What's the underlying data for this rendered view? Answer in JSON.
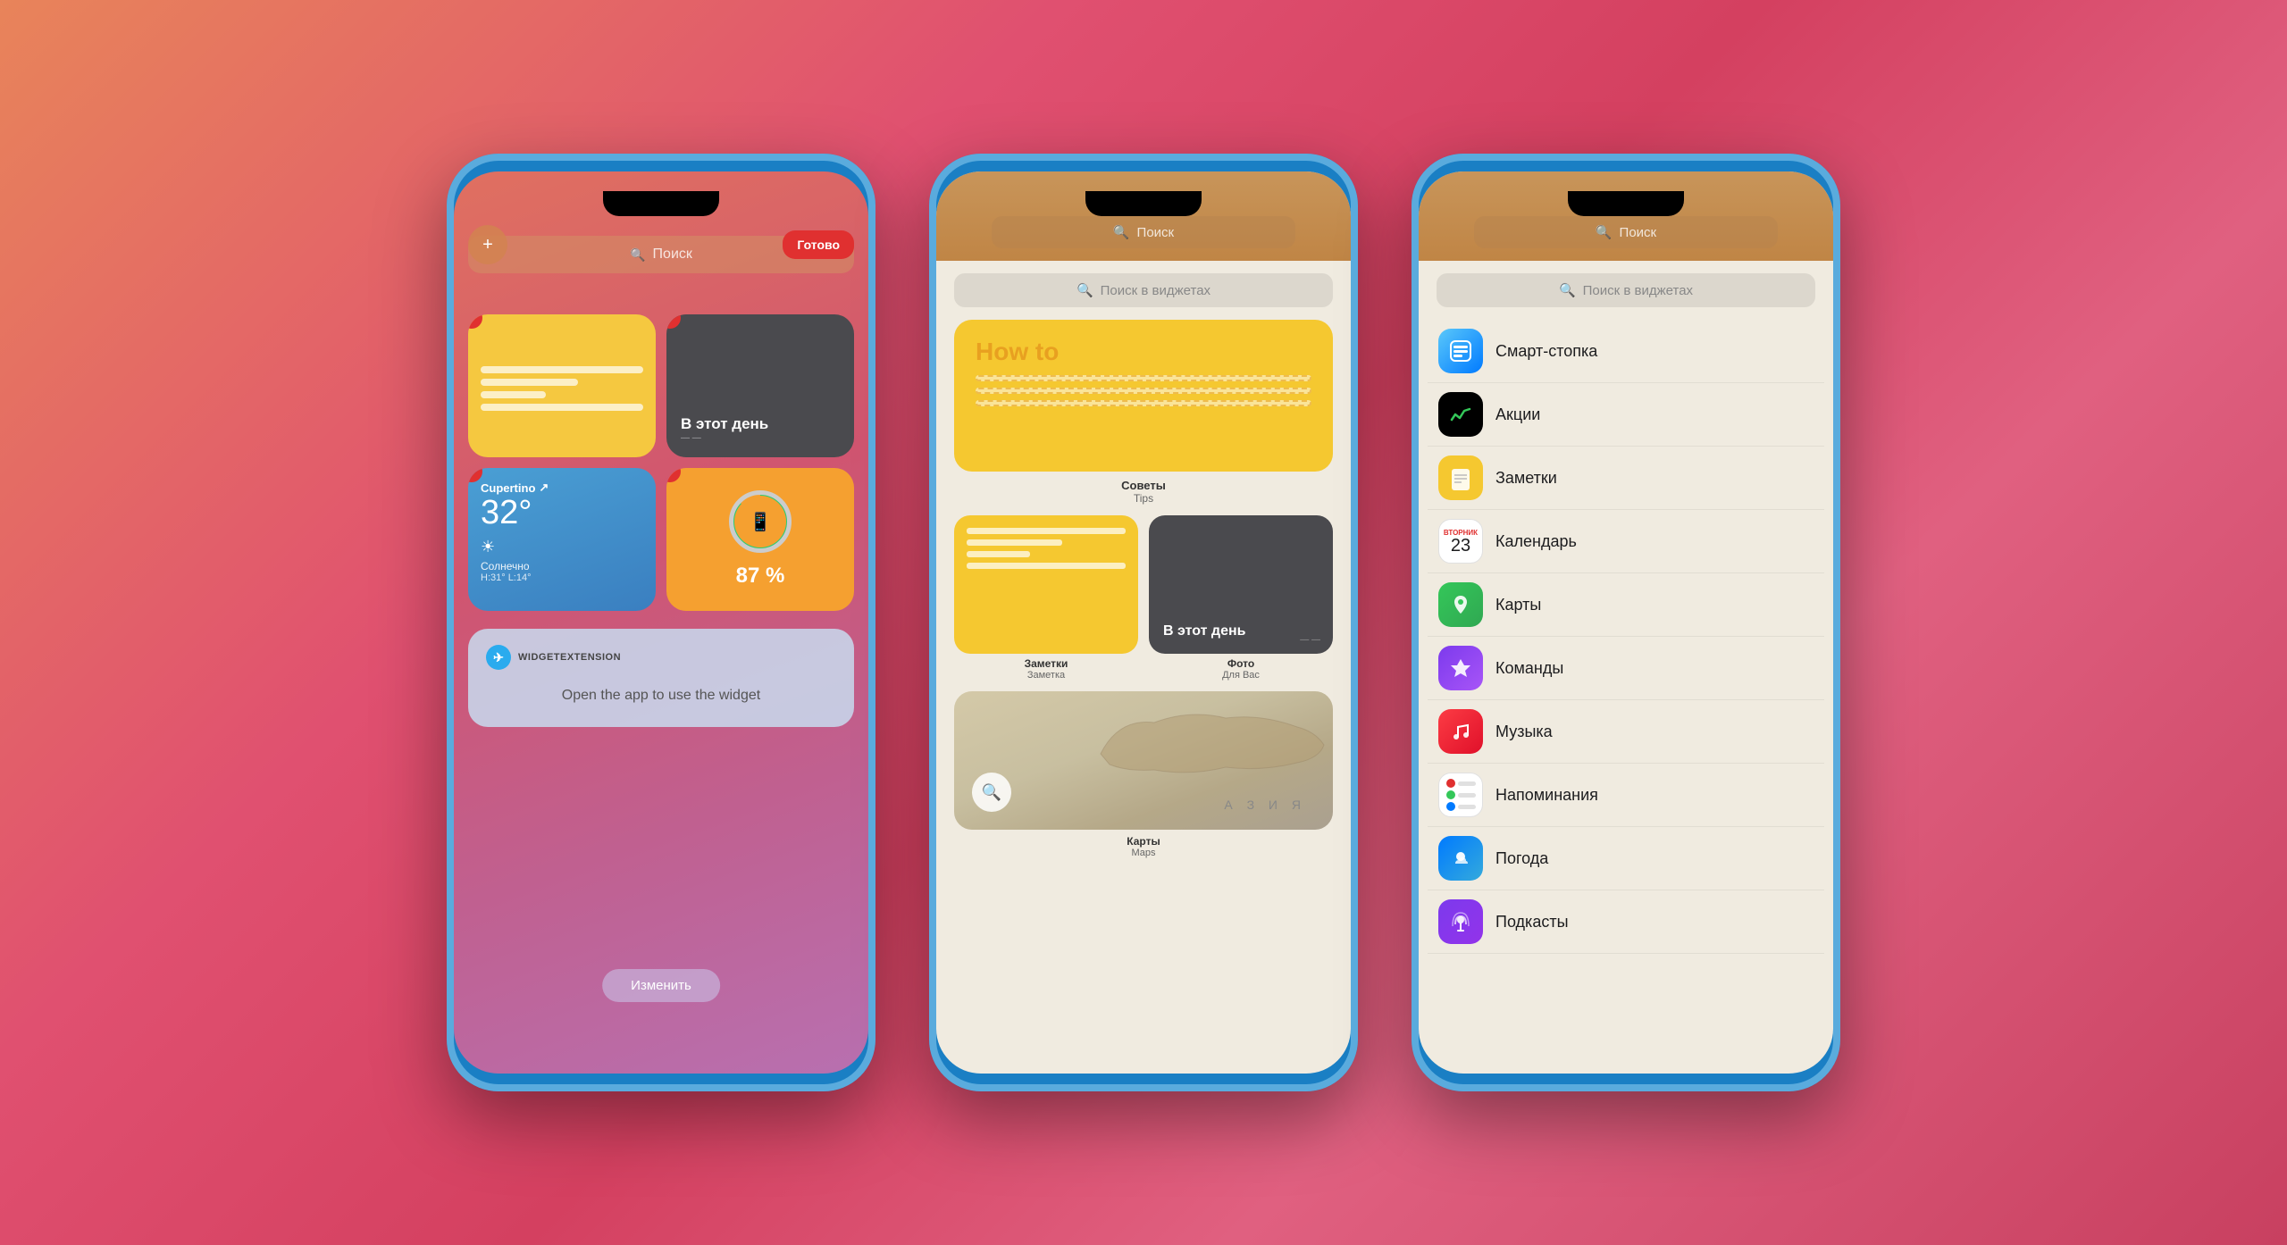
{
  "background": {
    "gradient": "linear-gradient(135deg, #e8845a 0%, #e05070 30%, #d44060 50%, #e06080 70%, #c84060 100%)"
  },
  "phone1": {
    "add_button": "+",
    "done_button": "Готово",
    "search_placeholder": "Поиск",
    "notes_widget": "Заметки",
    "today_widget": "В этот день",
    "weather_location": "Cupertino",
    "weather_temp": "32°",
    "weather_condition": "Солнечно",
    "weather_range": "H:31° L:14°",
    "battery_percent": "87 %",
    "telegram_label": "WIDGETEXTENSION",
    "telegram_content": "Open the app to use the widget",
    "edit_button": "Изменить"
  },
  "phone2": {
    "search_placeholder": "Поиск",
    "widget_search_placeholder": "Поиск в виджетах",
    "tips_howto": "How to",
    "tips_label": "Советы",
    "tips_sublabel": "Tips",
    "notes_label": "Заметки",
    "notes_sublabel": "Заметка",
    "photos_label": "Фото",
    "photos_text": "В этот день",
    "photos_sublabel": "Для Вас",
    "maps_label": "Карты",
    "maps_sublabel": "Maps",
    "asia_text": "А З И Я"
  },
  "phone3": {
    "search_placeholder": "Поиск",
    "widget_search_placeholder": "Поиск в виджетах",
    "apps": [
      {
        "name": "Смарт-стопка",
        "icon_class": "app-icon-smartstack",
        "icon_symbol": "⊡"
      },
      {
        "name": "Акции",
        "icon_class": "app-icon-stocks",
        "icon_symbol": "📈"
      },
      {
        "name": "Заметки",
        "icon_class": "app-icon-notes",
        "icon_symbol": "📝"
      },
      {
        "name": "Календарь",
        "icon_class": "app-icon-calendar",
        "icon_symbol": "23"
      },
      {
        "name": "Карты",
        "icon_class": "app-icon-maps",
        "icon_symbol": "🗺"
      },
      {
        "name": "Команды",
        "icon_class": "app-icon-shortcuts",
        "icon_symbol": "✦"
      },
      {
        "name": "Музыка",
        "icon_class": "app-icon-music",
        "icon_symbol": "♪"
      },
      {
        "name": "Напоминания",
        "icon_class": "app-icon-reminders",
        "icon_symbol": "●"
      },
      {
        "name": "Погода",
        "icon_class": "app-icon-weather",
        "icon_symbol": "🌤"
      },
      {
        "name": "Подкасты",
        "icon_class": "app-icon-podcasts",
        "icon_symbol": "🎙"
      }
    ],
    "calendar_day_label": "Вторник",
    "calendar_date": "23"
  }
}
